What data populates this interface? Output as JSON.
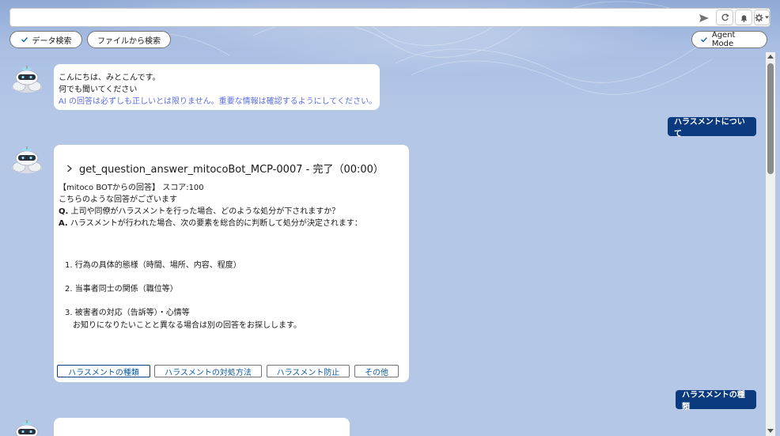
{
  "search": {
    "placeholder": "",
    "value": ""
  },
  "toolbar": {
    "data_search_label": "データ検索",
    "file_search_label": "ファイルから検索",
    "agent_mode_label": "Agent Mode"
  },
  "messages": {
    "greeting": {
      "line1": "こんにちは、みとこんです。",
      "line2": "何でも聞いてください",
      "disclaimer": "AI の回答は必ずしも正しいとは限りません。重要な情報は確認するようにしてください。"
    },
    "user1": "ハラスメントについて",
    "answer": {
      "tool_title": "get_question_answer_mitocoBot_MCP-0007 - 完了（00:00）",
      "source": "【mitoco BOTからの回答】 スコア:100",
      "intro": "こちらのような回答がございます",
      "q_prefix": "Q.",
      "question": " 上司や同僚がハラスメントを行った場合、どのような処分が下されますか？",
      "a_prefix": "A.",
      "answer": " ハラスメントが行われた場合、次の要素を総合的に判断して処分が決定されます：",
      "item1": "1. 行為の具体的態様（時間、場所、内容、程度）",
      "item2": "2. 当事者同士の関係（職位等）",
      "item3": "3. 被害者の対応（告訴等）・心情等",
      "note": "お知りになりたいことと異なる場合は別の回答をお探しします。",
      "chips": [
        "ハラスメントの種類",
        "ハラスメントの対処方法",
        "ハラスメント防止",
        "その他"
      ]
    },
    "user2": "ハラスメントの種類"
  },
  "colors": {
    "user_bubble": "#0b3a7e",
    "link": "#0b5cab",
    "disclaimer": "#5b6ee0"
  },
  "icons": [
    "send-icon",
    "refresh-icon",
    "bell-icon",
    "gear-icon",
    "check-icon",
    "chevron-right-icon",
    "robot-avatar-icon"
  ]
}
